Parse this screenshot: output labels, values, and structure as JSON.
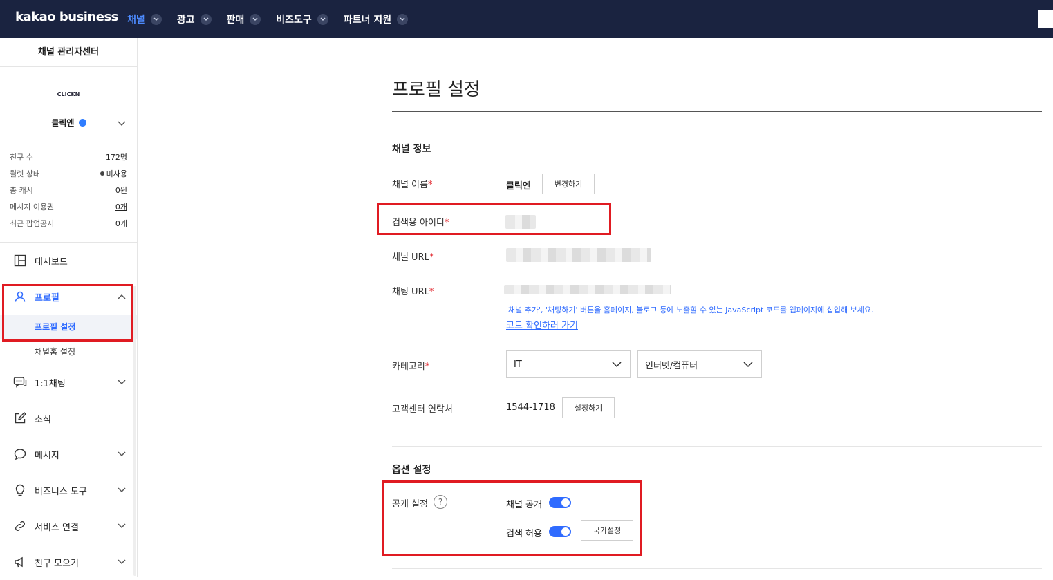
{
  "topbar": {
    "logo": "kakao business",
    "nav": [
      {
        "label": "채널",
        "active": true
      },
      {
        "label": "광고",
        "active": false
      },
      {
        "label": "판매",
        "active": false
      },
      {
        "label": "비즈도구",
        "active": false
      },
      {
        "label": "파트너 지원",
        "active": false
      }
    ]
  },
  "sidebar": {
    "title": "채널 관리자센터",
    "profile_logo": "CLICKN",
    "profile_name": "클릭엔",
    "stats": [
      {
        "label": "친구 수",
        "value": "172명"
      },
      {
        "label": "월렛 상태",
        "value": "미사용"
      },
      {
        "label": "총 캐시",
        "value": "0원"
      },
      {
        "label": "메시지 이용권",
        "value": "0개"
      },
      {
        "label": "최근 팝업공지",
        "value": "0개"
      }
    ],
    "menu": {
      "dashboard": "대시보드",
      "profile": "프로필",
      "profile_settings": "프로필 설정",
      "channel_home": "채널홈 설정",
      "chat": "1:1채팅",
      "news": "소식",
      "message": "메시지",
      "biz_tools": "비즈니스 도구",
      "service_link": "서비스 연결",
      "friends": "친구 모으기"
    }
  },
  "main": {
    "title": "프로필 설정",
    "channel_info": {
      "heading": "채널 정보",
      "name_label": "채널 이름",
      "name_value": "클릭엔",
      "change_button": "변경하기",
      "search_id_label": "검색용 아이디",
      "url_label": "채널 URL",
      "chat_url_label": "채팅 URL",
      "hint": "'채널 추가', '채팅하기' 버튼을 홈페이지, 블로그 등에 노출할 수 있는 JavaScript 코드를 웹페이지에 삽입해 보세요.",
      "hint_link": "코드 확인하러 가기",
      "category_label": "카테고리",
      "category_1": "IT",
      "category_2": "인터넷/컴퓨터",
      "contact_label": "고객센터 연락처",
      "contact_value": "1544-1718",
      "contact_button": "설정하기"
    },
    "options": {
      "heading": "옵션 설정",
      "visibility_label": "공개 설정",
      "help_mark": "?",
      "public_label": "채널 공개",
      "public_on": true,
      "search_label": "검색 허용",
      "search_on": true,
      "country_button": "국가설정"
    }
  },
  "colors": {
    "accent": "#2f6bff",
    "topbar": "#1a2340",
    "highlight": "#e01b22"
  }
}
